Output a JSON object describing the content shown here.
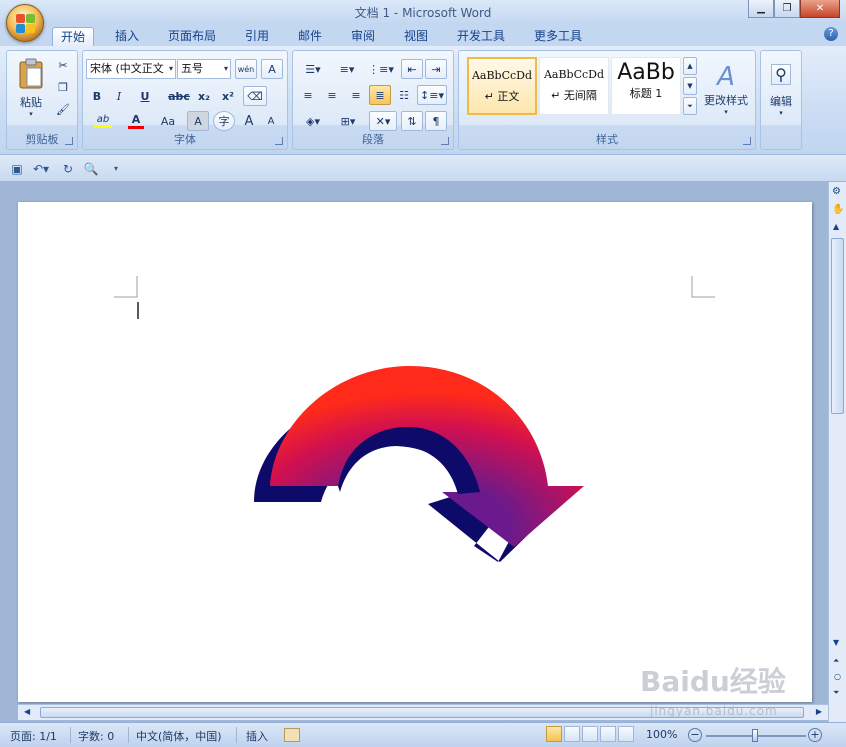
{
  "window": {
    "title": "文档 1 - Microsoft Word"
  },
  "tabs": [
    "开始",
    "插入",
    "页面布局",
    "引用",
    "邮件",
    "审阅",
    "视图",
    "开发工具",
    "更多工具"
  ],
  "ribbon": {
    "clipboard": {
      "paste_label": "粘贴",
      "group_label": "剪贴板"
    },
    "font": {
      "font_name": "宋体 (中文正文",
      "font_size": "五号",
      "group_label": "字体",
      "bold": "B",
      "italic": "I",
      "underline": "U",
      "strike": "abc",
      "sub": "x₂",
      "sup": "x²",
      "case": "Aa",
      "grow": "A",
      "shrink": "A",
      "phonetic": "wén",
      "border_char": "A",
      "shading_char": "A",
      "enclose_char": "字",
      "highlight": "ab",
      "font_color": "A"
    },
    "paragraph": {
      "group_label": "段落"
    },
    "styles": {
      "group_label": "样式",
      "items": [
        {
          "preview": "AaBbCcDd",
          "name": "↵ 正文"
        },
        {
          "preview": "AaBbCcDd",
          "name": "↵ 无间隔"
        },
        {
          "preview": "AaBb",
          "name": "标题 1"
        }
      ],
      "change_label": "更改样式"
    },
    "editing": {
      "label": "编辑"
    }
  },
  "status": {
    "page": "页面: 1/1",
    "words": "字数: 0",
    "lang": "中文(简体，中国)",
    "mode": "插入",
    "zoom": "100%"
  },
  "watermark": {
    "logo": "Baidu经验",
    "url": "jingyan.baidu.com"
  },
  "colors": {
    "arrow_face_start": "#e8002a",
    "arrow_face_mid": "#8b1d8e",
    "arrow_face_end": "#ff9a00",
    "arrow_side": "#0e0a6a"
  }
}
